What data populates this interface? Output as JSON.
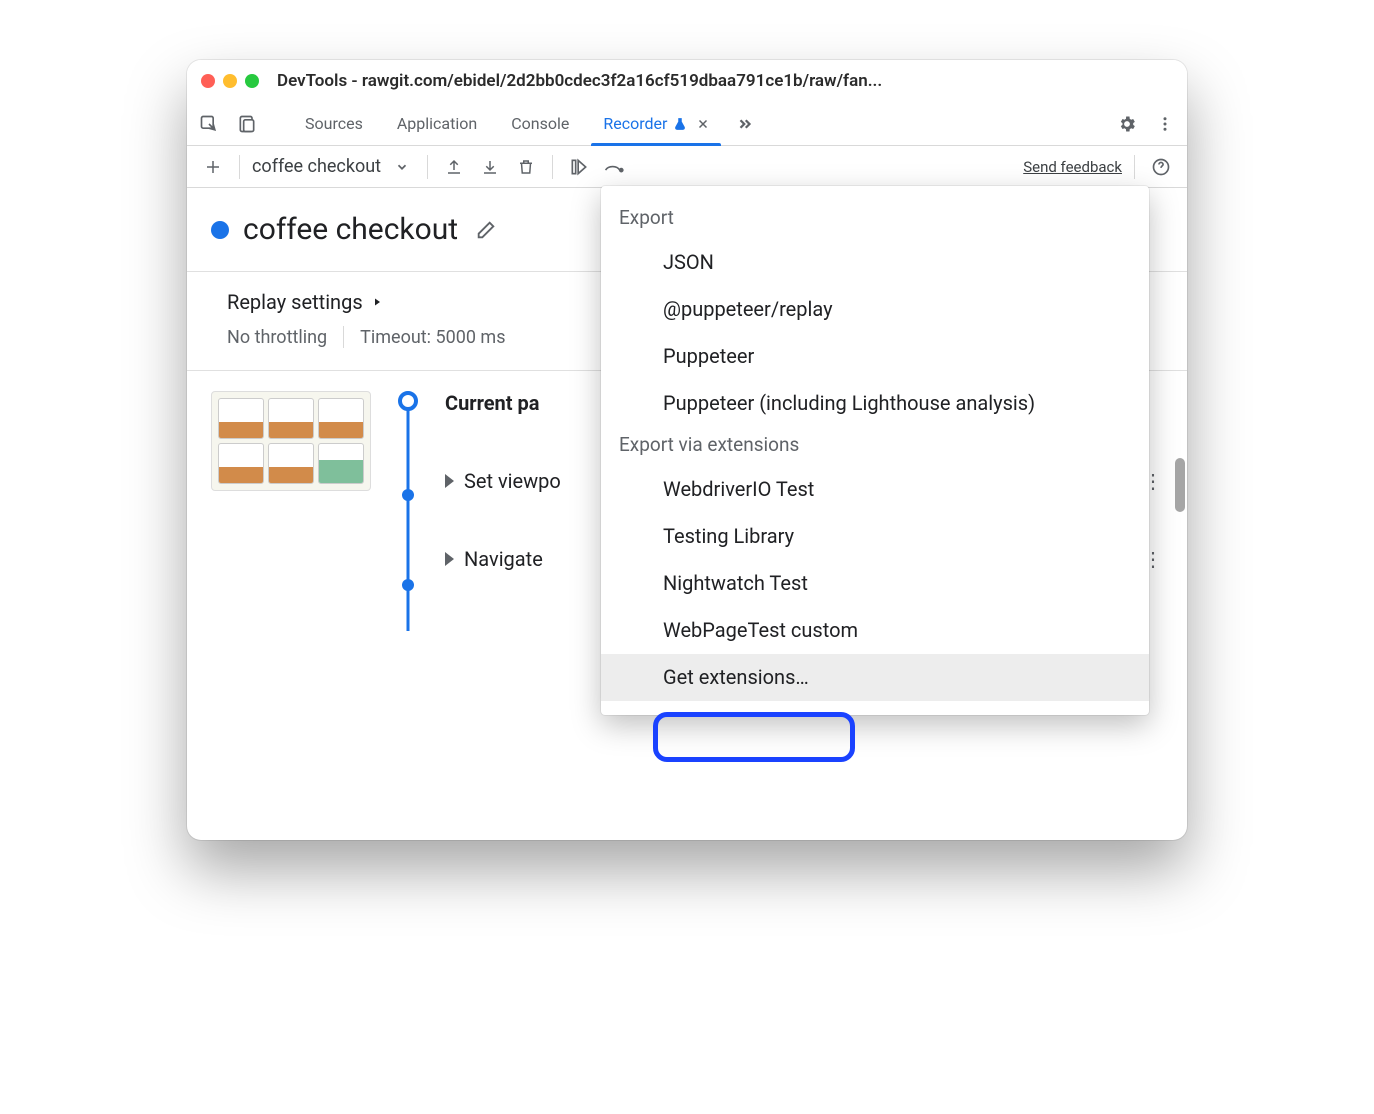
{
  "window": {
    "title": "DevTools - rawgit.com/ebidel/2d2bb0cdec3f2a16cf519dbaa791ce1b/raw/fan..."
  },
  "tabs": {
    "sources": "Sources",
    "application": "Application",
    "console": "Console",
    "recorder": "Recorder"
  },
  "toolbar": {
    "recording_name": "coffee checkout",
    "send_feedback": "Send feedback"
  },
  "recording": {
    "title": "coffee checkout"
  },
  "settings": {
    "header": "Replay settings",
    "throttling": "No throttling",
    "timeout": "Timeout: 5000 ms"
  },
  "steps": {
    "current": "Current pa",
    "set_viewport": "Set viewpo",
    "navigate": "Navigate"
  },
  "export": {
    "group1": "Export",
    "items1": {
      "json": "JSON",
      "puppeteer_replay": "@puppeteer/replay",
      "puppeteer": "Puppeteer",
      "puppeteer_lh": "Puppeteer (including Lighthouse analysis)"
    },
    "group2": "Export via extensions",
    "items2": {
      "webdriverio": "WebdriverIO Test",
      "testing_library": "Testing Library",
      "nightwatch": "Nightwatch Test",
      "webpagetest": "WebPageTest custom",
      "get_extensions": "Get extensions…"
    }
  }
}
